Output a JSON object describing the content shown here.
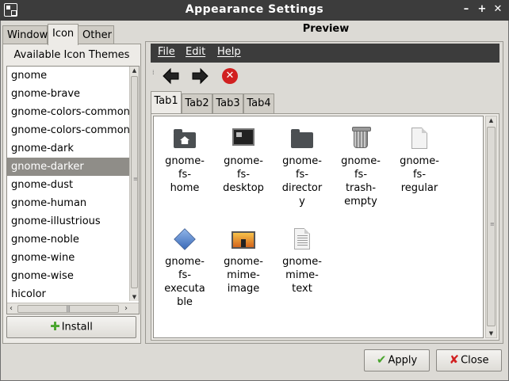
{
  "window": {
    "title": "Appearance Settings",
    "buttons": [
      "–",
      "+",
      "✕"
    ]
  },
  "left_tabs": [
    {
      "label": "Window",
      "active": false
    },
    {
      "label": "Icon",
      "active": true
    },
    {
      "label": "Other",
      "active": false
    }
  ],
  "themes": {
    "title": "Available Icon Themes",
    "items": [
      "gnome",
      "gnome-brave",
      "gnome-colors-common",
      "gnome-colors-common",
      "gnome-dark",
      "gnome-darker",
      "gnome-dust",
      "gnome-human",
      "gnome-illustrious",
      "gnome-noble",
      "gnome-wine",
      "gnome-wise",
      "hicolor"
    ],
    "selected": "gnome-darker",
    "install_label": "Install"
  },
  "preview": {
    "title": "Preview",
    "menu": [
      "File",
      "Edit",
      "Help"
    ],
    "tabs": [
      "Tab1",
      "Tab2",
      "Tab3",
      "Tab4"
    ],
    "active_tab": "Tab1",
    "icons": [
      {
        "label": "gnome-\nfs-\nhome",
        "icon": "folder-home-icon"
      },
      {
        "label": "gnome-\nfs-\ndesktop",
        "icon": "desktop-icon"
      },
      {
        "label": "gnome-\nfs-\ndirector\ny",
        "icon": "folder-icon"
      },
      {
        "label": "gnome-\nfs-\ntrash-\nempty",
        "icon": "trash-icon"
      },
      {
        "label": "gnome-\nfs-\nregular",
        "icon": "file-icon"
      },
      {
        "label": "gnome-\nfs-\nexecuta\nble",
        "icon": "executable-icon"
      },
      {
        "label": "gnome-\nmime-\nimage",
        "icon": "image-icon"
      },
      {
        "label": "gnome-\nmime-\ntext",
        "icon": "text-file-icon"
      }
    ]
  },
  "footer": {
    "apply_label": "Apply",
    "close_label": "Close"
  },
  "colors": {
    "titlebar": "#3c3c3c",
    "selection": "#8f8d88",
    "window": "#dcdad5"
  }
}
